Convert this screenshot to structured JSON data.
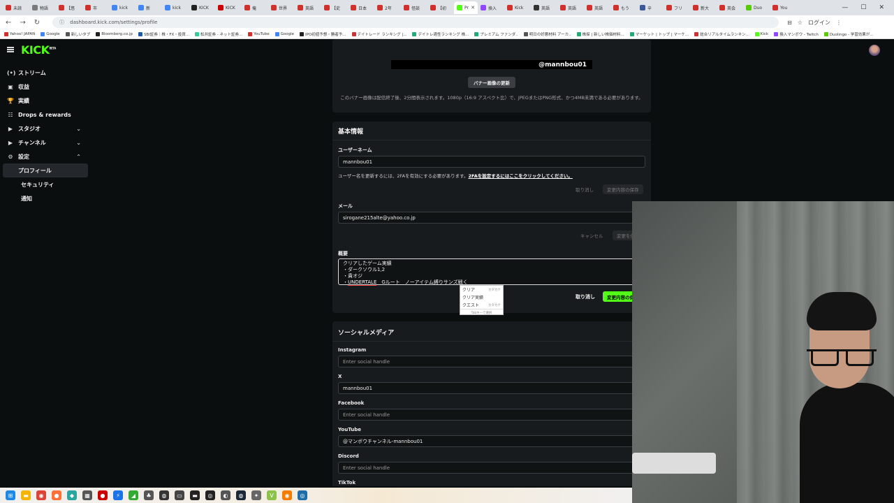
{
  "browser": {
    "tabs": [
      {
        "label": "未読",
        "color": "#d0312d"
      },
      {
        "label": "物語",
        "color": "#7a7a7a"
      },
      {
        "label": "【悠",
        "color": "#d0312d"
      },
      {
        "label": "市",
        "color": "#d0312d"
      },
      {
        "label": "kick",
        "color": "#4285f4"
      },
      {
        "label": "新",
        "color": "#4285f4"
      },
      {
        "label": "kick",
        "color": "#4285f4"
      },
      {
        "label": "KICK",
        "color": "#222"
      },
      {
        "label": "KICK",
        "color": "#c00"
      },
      {
        "label": "俺",
        "color": "#d0312d"
      },
      {
        "label": "世界",
        "color": "#d0312d"
      },
      {
        "label": "英語",
        "color": "#d0312d"
      },
      {
        "label": "【史",
        "color": "#d0312d"
      },
      {
        "label": "日本",
        "color": "#d0312d"
      },
      {
        "label": "2年",
        "color": "#d0312d"
      },
      {
        "label": "怪談",
        "color": "#d0312d"
      },
      {
        "label": "【初",
        "color": "#d0312d"
      },
      {
        "label": "Pr",
        "color": "#53fc18",
        "active": true
      },
      {
        "label": "換入",
        "color": "#9146ff"
      },
      {
        "label": "Kick",
        "color": "#d0312d"
      },
      {
        "label": "英語",
        "color": "#333"
      },
      {
        "label": "英語",
        "color": "#d0312d"
      },
      {
        "label": "英語",
        "color": "#d0312d"
      },
      {
        "label": "もう",
        "color": "#d0312d"
      },
      {
        "label": "辛",
        "color": "#3b5998"
      },
      {
        "label": "フリ",
        "color": "#d0312d"
      },
      {
        "label": "新大",
        "color": "#d0312d"
      },
      {
        "label": "英会",
        "color": "#d0312d"
      },
      {
        "label": "Duo",
        "color": "#58cc02"
      },
      {
        "label": "You",
        "color": "#d0312d"
      }
    ],
    "url": "dashboard.kick.com/settings/profile",
    "login_label": "ログイン",
    "bookmarks": [
      {
        "label": "Yahoo! JAPAN",
        "color": "#d0312d"
      },
      {
        "label": "Google",
        "color": "#4285f4"
      },
      {
        "label": "新しいタブ",
        "color": "#555"
      },
      {
        "label": "Bloomberg.co.jp",
        "color": "#222"
      },
      {
        "label": "SBI証券｜株・FX・投資...",
        "color": "#1a5aa6"
      },
      {
        "label": "松井証券 - ネット証券...",
        "color": "#3c9"
      },
      {
        "label": "YouTube",
        "color": "#d0312d"
      },
      {
        "label": "Google",
        "color": "#4285f4"
      },
      {
        "label": "IPO初値予想・勝者予...",
        "color": "#222"
      },
      {
        "label": "デイトレード ランキング |...",
        "color": "#c33"
      },
      {
        "label": "デイトレ適性ランキング 株...",
        "color": "#2a7"
      },
      {
        "label": "プレミアム ファンダ..",
        "color": "#2a7"
      },
      {
        "label": "明日の好悪材料 アーカ..",
        "color": "#555"
      },
      {
        "label": "株探 | 新しい株価材料...",
        "color": "#2a7"
      },
      {
        "label": "マーケット | トップ | マーケ...",
        "color": "#2a7"
      },
      {
        "label": "総合リアルタイムランキン...",
        "color": "#c33"
      },
      {
        "label": "Kick",
        "color": "#53fc18"
      },
      {
        "label": "換入マンボウ - Twitch",
        "color": "#9146ff"
      },
      {
        "label": "Duolingo - 学習効果が...",
        "color": "#58cc02"
      }
    ]
  },
  "app": {
    "logo": "KICK",
    "logo_badge": "BETA",
    "nav": [
      {
        "id": "stream",
        "icon": "(•)",
        "label": "ストリーム"
      },
      {
        "id": "revenue",
        "icon": "▣",
        "label": "収益"
      },
      {
        "id": "achievements",
        "icon": "🏆",
        "label": "実績"
      },
      {
        "id": "drops",
        "icon": "☷",
        "label": "Drops & rewards"
      },
      {
        "id": "studio",
        "icon": "▶",
        "label": "スタジオ",
        "chevron": "⌄"
      },
      {
        "id": "channel",
        "icon": "▶",
        "label": "チャンネル",
        "chevron": "⌄"
      },
      {
        "id": "settings",
        "icon": "⚙",
        "label": "設定",
        "chevron": "⌃"
      }
    ],
    "settings_sub": [
      {
        "label": "プロフィール",
        "active": true
      },
      {
        "label": "セキュリティ"
      },
      {
        "label": "通知"
      }
    ]
  },
  "banner": {
    "handle": "@mannbou01",
    "update_button": "バナー画像の更新",
    "note": "このバナー画像は配信終了後、2分間表示されます。1080p（16:9 アスペクト比）で、JPEGまたはPNG形式、かつ4MB未満である必要があります。"
  },
  "basic_info": {
    "title": "基本情報",
    "username_label": "ユーザーネーム",
    "username_value": "mannbou01",
    "username_hint": "ユーザー名を更新するには、2FAを有効にする必要があります。",
    "username_hint_link": "2FAを設定するにはここをクリックしてください。",
    "reset_label": "取り消し",
    "save_label": "変更内容の保存",
    "email_label": "メール",
    "email_value": "sirogane215alte@yahoo.co.jp",
    "cancel_label": "キャンセル",
    "email_save_label": "変更を保存",
    "bio_label": "概要",
    "bio_lines": [
      "クリアしたゲーム実績",
      "・ダークソウル1,2",
      "・貴オジ",
      "・UNDERTALE　Gルート　ノーアイテム縛りサンズ戦く"
    ],
    "bio_underlined": "UNDERTALE",
    "bio_rest": "　Gルート　ノーアイテム縛りサンズ戦く",
    "bio_prefix": "・",
    "ime": {
      "candidates": [
        {
          "text": "クリア",
          "hint": "カタカナ"
        },
        {
          "text": "クリア実績",
          "hint": ""
        },
        {
          "text": "クエスト",
          "hint": "カタカナ"
        }
      ],
      "footer": "Tabキーで選択"
    },
    "bio_reset_label": "取り消し",
    "bio_save_label": "変更内容の保存"
  },
  "social": {
    "title": "ソーシャルメディア",
    "fields": [
      {
        "label": "Instagram",
        "value": "",
        "placeholder": "Enter social handle"
      },
      {
        "label": "X",
        "value": "mannbou01",
        "placeholder": ""
      },
      {
        "label": "Facebook",
        "value": "",
        "placeholder": "Enter social handle"
      },
      {
        "label": "YouTube",
        "value": "@マンボウチャンネル-mannbou01",
        "placeholder": ""
      },
      {
        "label": "Discord",
        "value": "",
        "placeholder": "Enter social handle"
      },
      {
        "label": "TikTok",
        "value": "",
        "placeholder": ""
      }
    ]
  },
  "taskbar": {
    "icons": [
      {
        "name": "windows-start-icon",
        "glyph": "⊞",
        "color": "#1e88e5"
      },
      {
        "name": "file-explorer-icon",
        "glyph": "▬",
        "color": "#f4b400"
      },
      {
        "name": "chrome-icon",
        "glyph": "◉",
        "color": "#db4437"
      },
      {
        "name": "firefox-icon",
        "glyph": "●",
        "color": "#ff7139"
      },
      {
        "name": "app-icon",
        "glyph": "◆",
        "color": "#2aa5a0"
      },
      {
        "name": "app-icon",
        "glyph": "▦",
        "color": "#555"
      },
      {
        "name": "record-icon",
        "glyph": "●",
        "color": "#c00"
      },
      {
        "name": "app-icon",
        "glyph": "⚡",
        "color": "#1a73e8"
      },
      {
        "name": "app-icon",
        "glyph": "◢",
        "color": "#3a3"
      },
      {
        "name": "app-icon",
        "glyph": "♣",
        "color": "#555"
      },
      {
        "name": "steam-icon",
        "glyph": "◍",
        "color": "#333"
      },
      {
        "name": "terminal-icon",
        "glyph": "▭",
        "color": "#444"
      },
      {
        "name": "app-icon",
        "glyph": "▬",
        "color": "#222"
      },
      {
        "name": "obs-icon",
        "glyph": "◎",
        "color": "#222"
      },
      {
        "name": "app-icon",
        "glyph": "◐",
        "color": "#555"
      },
      {
        "name": "steam-icon",
        "glyph": "◍",
        "color": "#1b2838"
      },
      {
        "name": "app-icon",
        "glyph": "✦",
        "color": "#666"
      },
      {
        "name": "app-icon",
        "glyph": "V",
        "color": "#8bc34a"
      },
      {
        "name": "app-icon",
        "glyph": "◉",
        "color": "#f57c00"
      },
      {
        "name": "app-icon",
        "glyph": "◎",
        "color": "#1e6fa8"
      }
    ]
  },
  "colors": {
    "accent": "#53fc18",
    "panel": "#181b1d",
    "background": "#0b0e0f"
  }
}
